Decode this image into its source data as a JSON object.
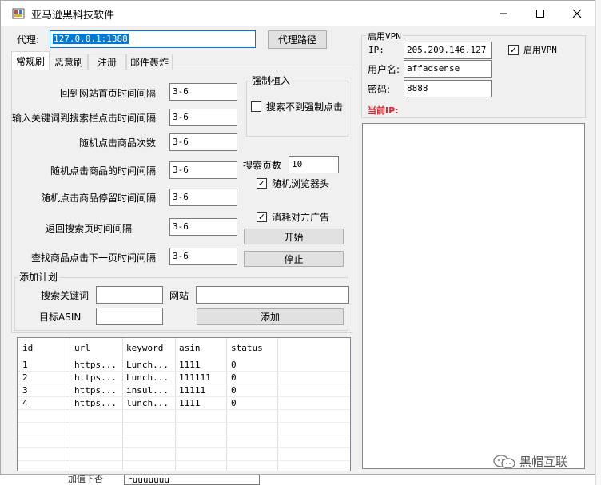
{
  "window": {
    "title": "亚马逊黑科技软件"
  },
  "proxy": {
    "label": "代理:",
    "value": "127.0.0.1:1388",
    "button": "代理路径"
  },
  "tabs": [
    {
      "label": "常规刷"
    },
    {
      "label": "恶意刷"
    },
    {
      "label": "注册"
    },
    {
      "label": "邮件轰炸"
    }
  ],
  "intervals": [
    {
      "label": "回到网站首页时间间隔",
      "value": "3-6"
    },
    {
      "label": "输入关键词到搜索栏点击时间间隔",
      "value": "3-6"
    },
    {
      "label": "随机点击商品次数",
      "value": "3-6"
    },
    {
      "label": "随机点击商品的时间间隔",
      "value": "3-6"
    },
    {
      "label": "随机点击商品停留时间间隔",
      "value": "3-6"
    },
    {
      "label": "返回搜索页时间间隔",
      "value": "3-6"
    },
    {
      "label": "查找商品点击下一页时间间隔",
      "value": "3-6"
    }
  ],
  "force": {
    "group_title": "强制植入",
    "checkbox": "搜索不到强制点击",
    "checked": false
  },
  "search_pages": {
    "label": "搜索页数",
    "value": "10"
  },
  "options": {
    "random_browser": {
      "label": "随机浏览器头",
      "checked": true
    },
    "consume_ads": {
      "label": "消耗对方广告",
      "checked": true
    }
  },
  "actions": {
    "start": "开始",
    "stop": "停止"
  },
  "plan": {
    "group_title": "添加计划",
    "keyword_label": "搜索关键词",
    "keyword_value": "",
    "site_label": "网站",
    "site_value": "",
    "asin_label": "目标ASIN",
    "asin_value": "",
    "add_button": "添加"
  },
  "table": {
    "columns": [
      "id",
      "url",
      "keyword",
      "asin",
      "status"
    ],
    "rows": [
      [
        "1",
        "https...",
        "Lunch...",
        "1111",
        "0"
      ],
      [
        "2",
        "https...",
        "Lunch...",
        "111111",
        "0"
      ],
      [
        "3",
        "https...",
        "insul...",
        "11111",
        "0"
      ],
      [
        "4",
        "https...",
        "lunch...",
        "1111",
        "0"
      ]
    ]
  },
  "vpn": {
    "group_title": "启用VPN",
    "ip_label": "IP:",
    "ip_value": "205.209.146.127",
    "user_label": "用户名:",
    "user_value": "affadsense",
    "pass_label": "密码:",
    "pass_value": "8888",
    "enable_label": "启用VPN",
    "enable_checked": true,
    "current_ip_label": "当前IP:"
  },
  "behind": {
    "text": "ruuuuuuu",
    "label": "加值下否"
  },
  "watermark": {
    "text": "黑帽互联"
  },
  "colors": {
    "accent": "#0078d7",
    "current_ip": "#e0262f"
  }
}
